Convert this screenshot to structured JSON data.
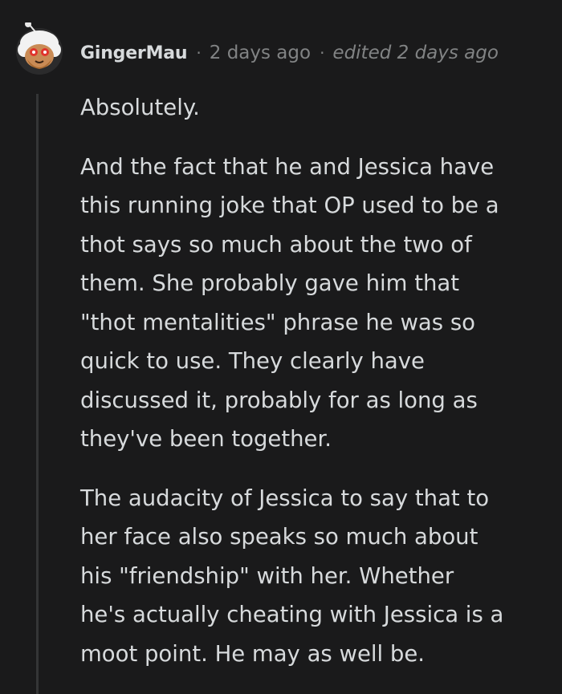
{
  "comment": {
    "author": "GingerMau",
    "timestamp": "2 days ago",
    "edited": "edited 2 days ago",
    "separator": "·",
    "avatar_icon": "snoo-avatar-icon",
    "paragraphs": [
      "Absolutely.",
      "And the fact that he and Jessica have\nthis running joke that OP used to be a\nthot says so much about the two of\nthem. She probably gave him that\n\"thot mentalities\" phrase he was so\nquick to use. They clearly have\ndiscussed it, probably for as long as\nthey've been together.",
      "The audacity of Jessica to say that to\nher face also speaks so much about\nhis \"friendship\" with her. Whether\nhe's actually cheating with Jessica is a\nmoot point. He may as well be."
    ]
  },
  "colors": {
    "background": "#1a1a1b",
    "text": "#d7dadc",
    "muted": "#818384",
    "thread_line": "#343536"
  }
}
